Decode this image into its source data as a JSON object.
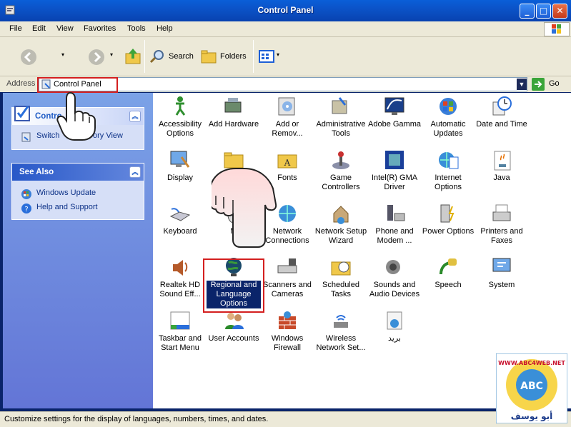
{
  "window": {
    "title": "Control Panel"
  },
  "menu": [
    "File",
    "Edit",
    "View",
    "Favorites",
    "Tools",
    "Help"
  ],
  "toolbar": {
    "search": "Search",
    "folders": "Folders"
  },
  "address": {
    "label": "Address",
    "value": "Control Panel",
    "go": "Go"
  },
  "left": {
    "panel1": {
      "title": "Control Panel",
      "title_visible": "Contro",
      "link_left": "Switch",
      "link_right": "ory View"
    },
    "panel2": {
      "title": "See Also",
      "links": [
        "Windows Update",
        "Help and Support"
      ]
    }
  },
  "items": [
    {
      "l1": "Accessibility",
      "l2": "Options",
      "icon": "accessibility-icon"
    },
    {
      "l1": "Add Hardware",
      "l2": "",
      "icon": "add-hardware-icon"
    },
    {
      "l1": "Add or",
      "l2": "Remov...",
      "icon": "add-remove-icon"
    },
    {
      "l1": "Administrative",
      "l2": "Tools",
      "icon": "admin-tools-icon"
    },
    {
      "l1": "Adobe Gamma",
      "l2": "",
      "icon": "adobe-gamma-icon"
    },
    {
      "l1": "Automatic",
      "l2": "Updates",
      "icon": "updates-icon"
    },
    {
      "l1": "Date and Time",
      "l2": "",
      "icon": "clock-icon"
    },
    {
      "l1": "Display",
      "l2": "",
      "icon": "display-icon"
    },
    {
      "l1": "Folde",
      "l2": "",
      "icon": "folder-icon"
    },
    {
      "l1": "Fonts",
      "l2": "",
      "icon": "fonts-icon"
    },
    {
      "l1": "Game",
      "l2": "Controllers",
      "icon": "joystick-icon"
    },
    {
      "l1": "Intel(R) GMA",
      "l2": "Driver",
      "icon": "intel-icon"
    },
    {
      "l1": "Internet",
      "l2": "Options",
      "icon": "internet-icon"
    },
    {
      "l1": "Java",
      "l2": "",
      "icon": "java-icon"
    },
    {
      "l1": "Keyboard",
      "l2": "",
      "icon": "keyboard-icon"
    },
    {
      "l1": "M",
      "l2": "",
      "icon": "mouse-icon"
    },
    {
      "l1": "Network",
      "l2": "Connections",
      "icon": "network-icon"
    },
    {
      "l1": "Network Setup",
      "l2": "Wizard",
      "icon": "network-wizard-icon"
    },
    {
      "l1": "Phone and",
      "l2": "Modem ...",
      "icon": "phone-icon"
    },
    {
      "l1": "Power Options",
      "l2": "",
      "icon": "power-icon"
    },
    {
      "l1": "Printers and",
      "l2": "Faxes",
      "icon": "printer-icon"
    },
    {
      "l1": "Realtek HD",
      "l2": "Sound Eff...",
      "icon": "speaker-icon"
    },
    {
      "l1": "Regional and",
      "l2": "Language",
      "l3": "Options",
      "icon": "globe-icon"
    },
    {
      "l1": "Scanners and",
      "l2": "Cameras",
      "icon": "scanner-icon"
    },
    {
      "l1": "Scheduled",
      "l2": "Tasks",
      "icon": "tasks-icon"
    },
    {
      "l1": "Sounds and",
      "l2": "Audio Devices",
      "icon": "sounds-icon"
    },
    {
      "l1": "Speech",
      "l2": "",
      "icon": "speech-icon"
    },
    {
      "l1": "System",
      "l2": "",
      "icon": "system-icon"
    },
    {
      "l1": "Taskbar and",
      "l2": "Start Menu",
      "icon": "taskbar-icon"
    },
    {
      "l1": "User Accounts",
      "l2": "",
      "icon": "users-icon"
    },
    {
      "l1": "Windows",
      "l2": "Firewall",
      "icon": "firewall-icon"
    },
    {
      "l1": "Wireless",
      "l2": "Network Set...",
      "icon": "wireless-icon"
    },
    {
      "l1": "بريد",
      "l2": "",
      "icon": "mail-icon"
    }
  ],
  "status": "Customize settings for the display of languages, numbers, times, and dates.",
  "watermark": {
    "line1": "WWW.ABC4WEB.NET",
    "line2": "أبو يوسف",
    "logo": "ABC"
  }
}
